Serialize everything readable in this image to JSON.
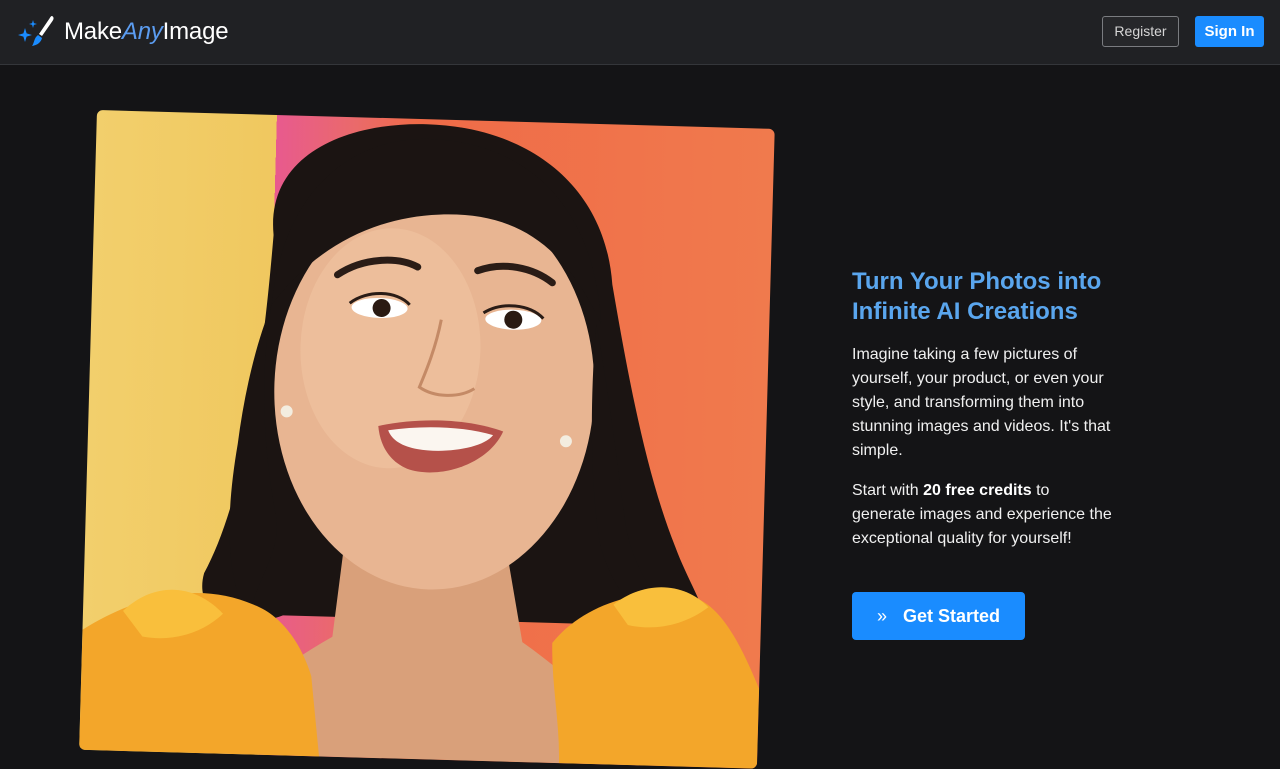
{
  "brand": {
    "name_part1": "Make",
    "name_part2": "Any",
    "name_part3": "Image",
    "icon": "sparkle-brush-icon",
    "accent_color": "#5b9cf0"
  },
  "nav": {
    "register_label": "Register",
    "signin_label": "Sign In"
  },
  "hero": {
    "image_subject": "smiling-woman-portrait",
    "headline": "Turn Your Photos into Infinite AI Creations",
    "paragraph1": "Imagine taking a few pictures of yourself, your product, or even your style, and transforming them into stunning images and videos. It's that simple.",
    "paragraph2_prefix": "Start with ",
    "paragraph2_bold": "20 free credits",
    "paragraph2_suffix": " to generate images and experience the exceptional quality for yourself!",
    "cta_label": "Get Started",
    "cta_icon": "double-chevron-right-icon"
  },
  "colors": {
    "background": "#141416",
    "navbar": "#202124",
    "primary": "#1a8cff",
    "headline": "#5aa6ee"
  }
}
